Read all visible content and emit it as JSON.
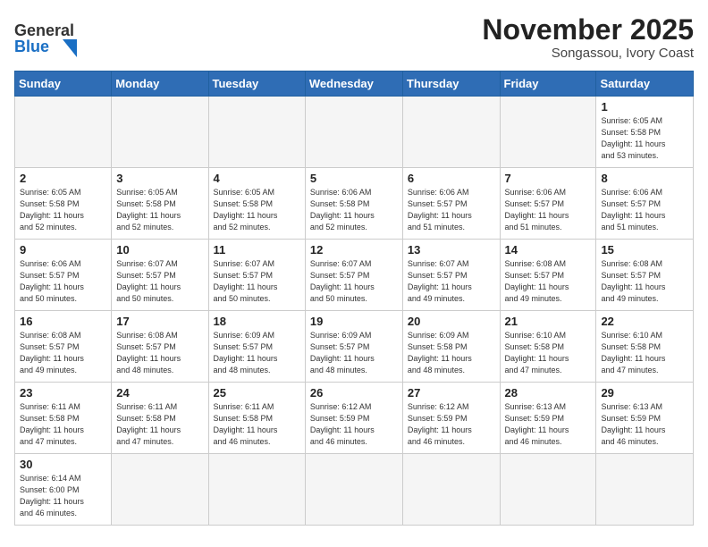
{
  "header": {
    "logo_general": "General",
    "logo_blue": "Blue",
    "main_title": "November 2025",
    "subtitle": "Songassou, Ivory Coast"
  },
  "weekdays": [
    "Sunday",
    "Monday",
    "Tuesday",
    "Wednesday",
    "Thursday",
    "Friday",
    "Saturday"
  ],
  "weeks": [
    [
      {
        "day": "",
        "info": ""
      },
      {
        "day": "",
        "info": ""
      },
      {
        "day": "",
        "info": ""
      },
      {
        "day": "",
        "info": ""
      },
      {
        "day": "",
        "info": ""
      },
      {
        "day": "",
        "info": ""
      },
      {
        "day": "1",
        "info": "Sunrise: 6:05 AM\nSunset: 5:58 PM\nDaylight: 11 hours\nand 53 minutes."
      }
    ],
    [
      {
        "day": "2",
        "info": "Sunrise: 6:05 AM\nSunset: 5:58 PM\nDaylight: 11 hours\nand 52 minutes."
      },
      {
        "day": "3",
        "info": "Sunrise: 6:05 AM\nSunset: 5:58 PM\nDaylight: 11 hours\nand 52 minutes."
      },
      {
        "day": "4",
        "info": "Sunrise: 6:05 AM\nSunset: 5:58 PM\nDaylight: 11 hours\nand 52 minutes."
      },
      {
        "day": "5",
        "info": "Sunrise: 6:06 AM\nSunset: 5:58 PM\nDaylight: 11 hours\nand 52 minutes."
      },
      {
        "day": "6",
        "info": "Sunrise: 6:06 AM\nSunset: 5:57 PM\nDaylight: 11 hours\nand 51 minutes."
      },
      {
        "day": "7",
        "info": "Sunrise: 6:06 AM\nSunset: 5:57 PM\nDaylight: 11 hours\nand 51 minutes."
      },
      {
        "day": "8",
        "info": "Sunrise: 6:06 AM\nSunset: 5:57 PM\nDaylight: 11 hours\nand 51 minutes."
      }
    ],
    [
      {
        "day": "9",
        "info": "Sunrise: 6:06 AM\nSunset: 5:57 PM\nDaylight: 11 hours\nand 50 minutes."
      },
      {
        "day": "10",
        "info": "Sunrise: 6:07 AM\nSunset: 5:57 PM\nDaylight: 11 hours\nand 50 minutes."
      },
      {
        "day": "11",
        "info": "Sunrise: 6:07 AM\nSunset: 5:57 PM\nDaylight: 11 hours\nand 50 minutes."
      },
      {
        "day": "12",
        "info": "Sunrise: 6:07 AM\nSunset: 5:57 PM\nDaylight: 11 hours\nand 50 minutes."
      },
      {
        "day": "13",
        "info": "Sunrise: 6:07 AM\nSunset: 5:57 PM\nDaylight: 11 hours\nand 49 minutes."
      },
      {
        "day": "14",
        "info": "Sunrise: 6:08 AM\nSunset: 5:57 PM\nDaylight: 11 hours\nand 49 minutes."
      },
      {
        "day": "15",
        "info": "Sunrise: 6:08 AM\nSunset: 5:57 PM\nDaylight: 11 hours\nand 49 minutes."
      }
    ],
    [
      {
        "day": "16",
        "info": "Sunrise: 6:08 AM\nSunset: 5:57 PM\nDaylight: 11 hours\nand 49 minutes."
      },
      {
        "day": "17",
        "info": "Sunrise: 6:08 AM\nSunset: 5:57 PM\nDaylight: 11 hours\nand 48 minutes."
      },
      {
        "day": "18",
        "info": "Sunrise: 6:09 AM\nSunset: 5:57 PM\nDaylight: 11 hours\nand 48 minutes."
      },
      {
        "day": "19",
        "info": "Sunrise: 6:09 AM\nSunset: 5:57 PM\nDaylight: 11 hours\nand 48 minutes."
      },
      {
        "day": "20",
        "info": "Sunrise: 6:09 AM\nSunset: 5:58 PM\nDaylight: 11 hours\nand 48 minutes."
      },
      {
        "day": "21",
        "info": "Sunrise: 6:10 AM\nSunset: 5:58 PM\nDaylight: 11 hours\nand 47 minutes."
      },
      {
        "day": "22",
        "info": "Sunrise: 6:10 AM\nSunset: 5:58 PM\nDaylight: 11 hours\nand 47 minutes."
      }
    ],
    [
      {
        "day": "23",
        "info": "Sunrise: 6:11 AM\nSunset: 5:58 PM\nDaylight: 11 hours\nand 47 minutes."
      },
      {
        "day": "24",
        "info": "Sunrise: 6:11 AM\nSunset: 5:58 PM\nDaylight: 11 hours\nand 47 minutes."
      },
      {
        "day": "25",
        "info": "Sunrise: 6:11 AM\nSunset: 5:58 PM\nDaylight: 11 hours\nand 46 minutes."
      },
      {
        "day": "26",
        "info": "Sunrise: 6:12 AM\nSunset: 5:59 PM\nDaylight: 11 hours\nand 46 minutes."
      },
      {
        "day": "27",
        "info": "Sunrise: 6:12 AM\nSunset: 5:59 PM\nDaylight: 11 hours\nand 46 minutes."
      },
      {
        "day": "28",
        "info": "Sunrise: 6:13 AM\nSunset: 5:59 PM\nDaylight: 11 hours\nand 46 minutes."
      },
      {
        "day": "29",
        "info": "Sunrise: 6:13 AM\nSunset: 5:59 PM\nDaylight: 11 hours\nand 46 minutes."
      }
    ],
    [
      {
        "day": "30",
        "info": "Sunrise: 6:14 AM\nSunset: 6:00 PM\nDaylight: 11 hours\nand 46 minutes."
      },
      {
        "day": "",
        "info": ""
      },
      {
        "day": "",
        "info": ""
      },
      {
        "day": "",
        "info": ""
      },
      {
        "day": "",
        "info": ""
      },
      {
        "day": "",
        "info": ""
      },
      {
        "day": "",
        "info": ""
      }
    ]
  ]
}
